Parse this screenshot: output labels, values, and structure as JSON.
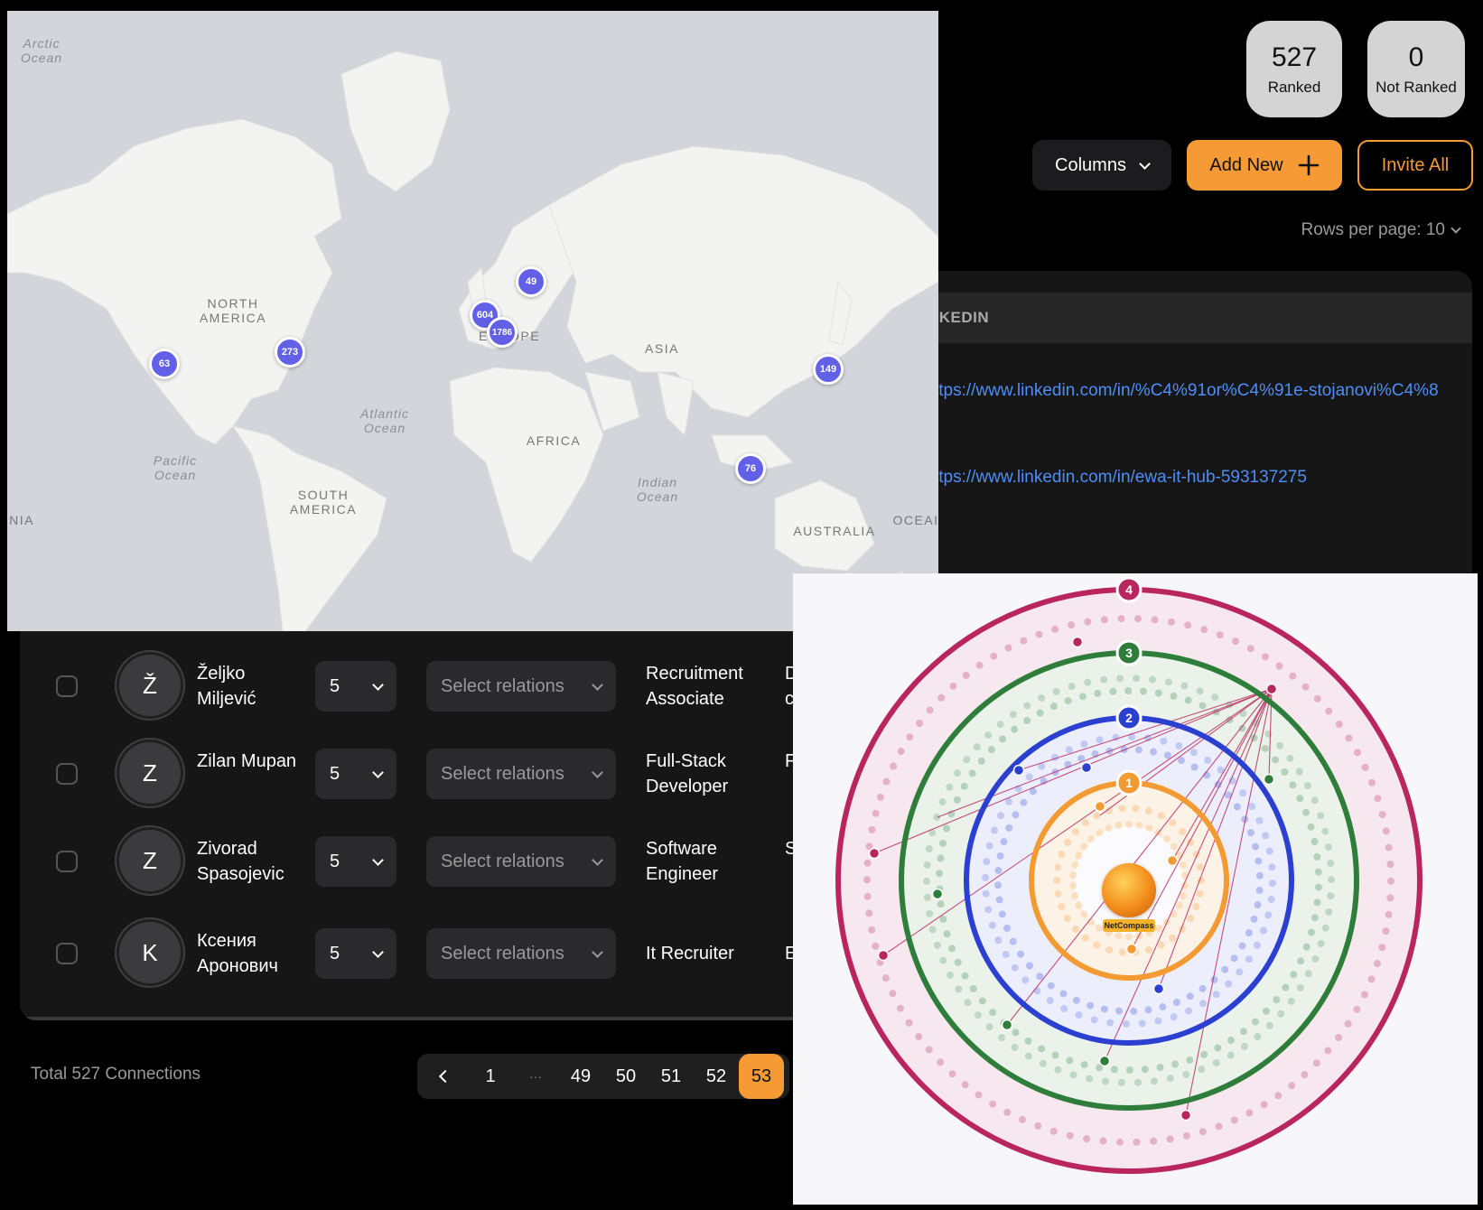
{
  "stats": [
    {
      "value": "527",
      "label": "Ranked"
    },
    {
      "value": "0",
      "label": "Not Ranked"
    }
  ],
  "toolbar": {
    "columns_label": "Columns",
    "add_new_label": "Add New",
    "invite_all_label": "Invite All",
    "rows_per_page": "Rows per page: 10"
  },
  "table": {
    "linkedin_header_fragment": "NKEDIN",
    "links": [
      "ttps://www.linkedin.com/in/%C4%91or%C4%91e-stojanovi%C4%8",
      "ttps://www.linkedin.com/in/ewa-it-hub-593137275"
    ],
    "rows": [
      {
        "initial": "Ž",
        "name": "Željko Miljević",
        "rank": "5",
        "relations_placeholder": "Select relations",
        "title": "Recruitment Associate",
        "cut": "D c"
      },
      {
        "initial": "Z",
        "name": "Zilan Mupan",
        "rank": "5",
        "relations_placeholder": "Select relations",
        "title": "Full-Stack Developer",
        "cut": "F"
      },
      {
        "initial": "Z",
        "name": "Zivorad Spasojevic",
        "rank": "5",
        "relations_placeholder": "Select relations",
        "title": "Software Engineer",
        "cut": "S"
      },
      {
        "initial": "K",
        "name": "Ксения Аронович",
        "rank": "5",
        "relations_placeholder": "Select relations",
        "title": "It Recruiter",
        "cut": "E"
      }
    ]
  },
  "footer": {
    "total": "Total 527 Connections",
    "pages": [
      "1",
      "···",
      "49",
      "50",
      "51",
      "52",
      "53"
    ],
    "active_page": "53"
  },
  "map": {
    "labels": {
      "arctic": "Arctic Ocean",
      "north_america": "NORTH AMERICA",
      "atlantic": "Atlantic Ocean",
      "pacific": "Pacific Ocean",
      "south_america": "SOUTH AMERICA",
      "europe": "EUROPE",
      "asia": "ASIA",
      "africa": "AFRICA",
      "indian": "Indian Ocean",
      "australia": "AUSTRALIA",
      "oceania_cut": "OCEAI",
      "nia_cut": "NIA"
    },
    "clusters": [
      "63",
      "273",
      "49",
      "604",
      "1786",
      "149",
      "76"
    ]
  },
  "radar": {
    "rings": [
      "1",
      "2",
      "3",
      "4"
    ],
    "logo_text": "NetCompass",
    "colors": {
      "ring1": "#f39a33",
      "ring2": "#2b3fd0",
      "ring3": "#2f7d3a",
      "ring4": "#b8255f"
    }
  },
  "colors": {
    "accent": "#f59a35",
    "link": "#4d8ef7",
    "cluster": "#6160e6"
  }
}
